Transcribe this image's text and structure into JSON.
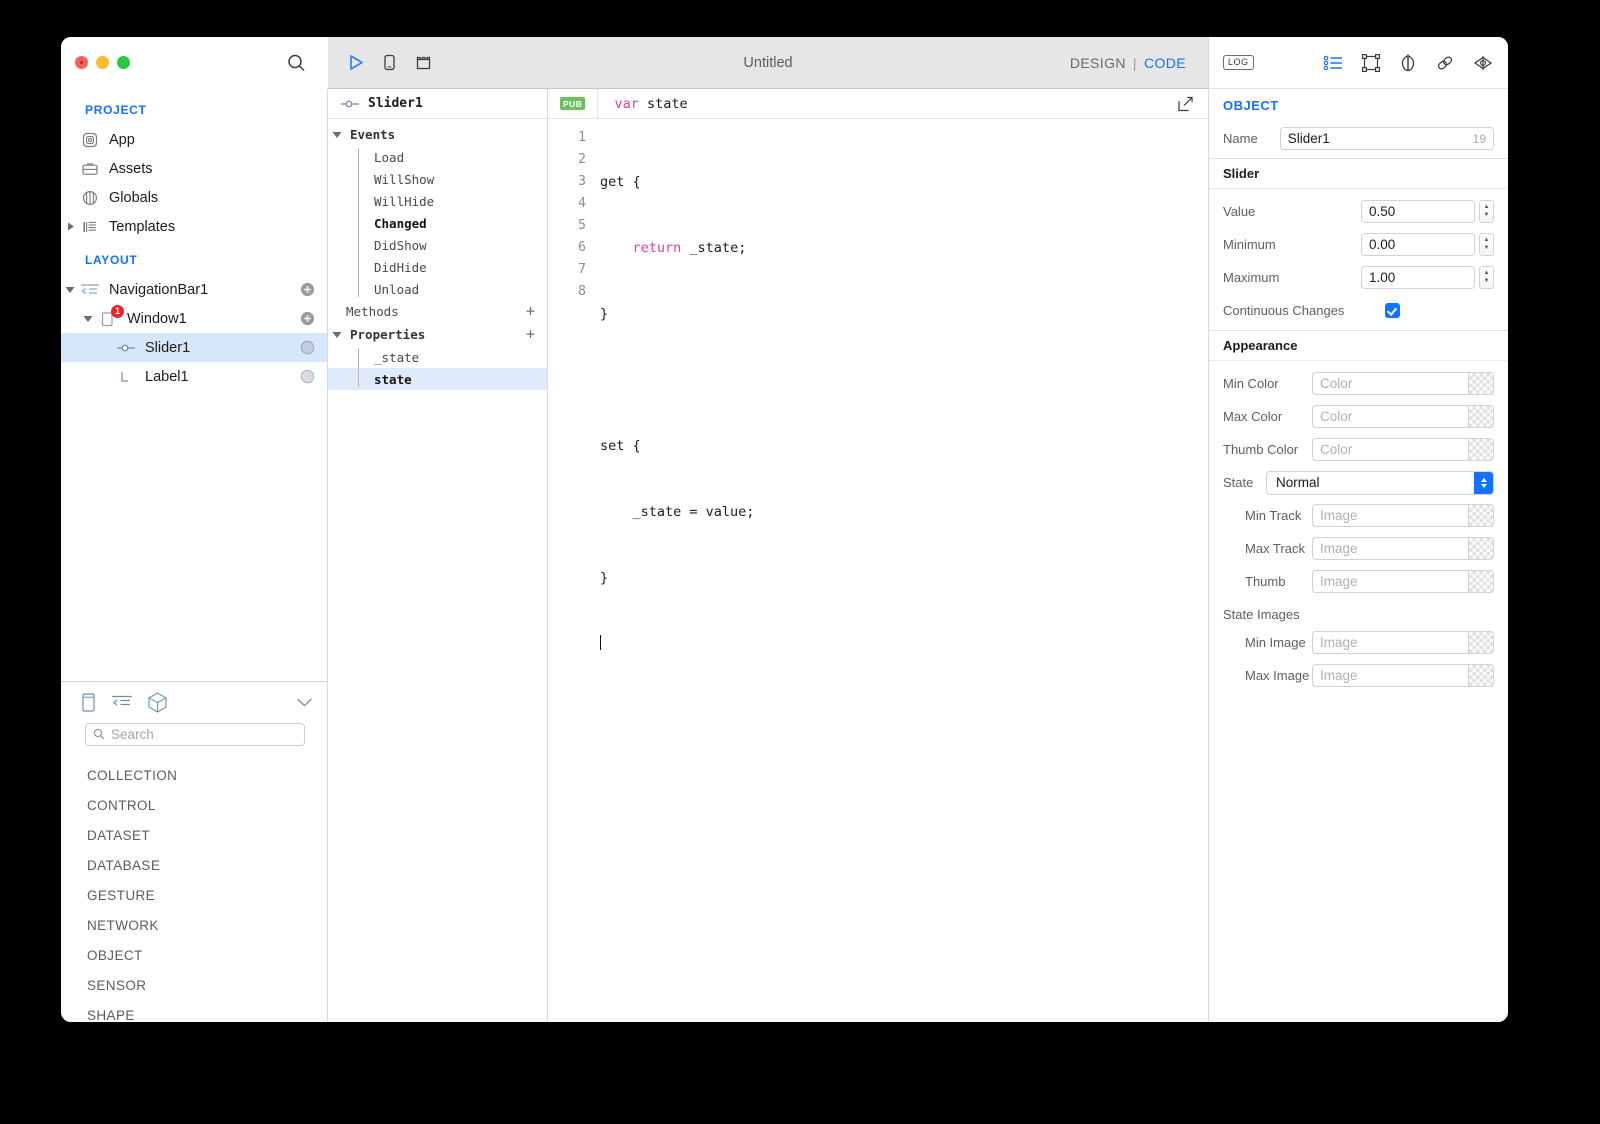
{
  "window": {
    "traffic_lights": [
      "close",
      "minimize",
      "maximize"
    ],
    "sidebar_search_icon": "search-icon"
  },
  "toolbar": {
    "run_icon": "play-triangle-icon",
    "device_icon": "phone-device-icon",
    "layout_icon": "storyboard-icon",
    "title": "Untitled",
    "mode_design": "DESIGN",
    "mode_separator": "|",
    "mode_code": "CODE",
    "accent_blue": "#1273ff"
  },
  "sidebar": {
    "project_header": "PROJECT",
    "project_items": [
      {
        "label": "App",
        "icon": "app-icon"
      },
      {
        "label": "Assets",
        "icon": "assets-briefcase-icon"
      },
      {
        "label": "Globals",
        "icon": "globals-cylinder-icon"
      },
      {
        "label": "Templates",
        "icon": "templates-icon"
      }
    ],
    "layout_header": "LAYOUT",
    "layout_items": [
      {
        "label": "NavigationBar1",
        "icon": "navigationbar-icon",
        "action": "add-icon",
        "badge": ""
      },
      {
        "label": "Window1",
        "icon": "window-icon",
        "action": "add-icon",
        "badge": "1"
      },
      {
        "label": "Slider1",
        "icon": "slider-icon",
        "action": "visibility-dot-icon",
        "badge": "",
        "selected": true
      },
      {
        "label": "Label1",
        "icon": "label-L-icon",
        "action": "visibility-dot-icon",
        "badge": ""
      }
    ]
  },
  "library": {
    "tabs": [
      "phone-outline-icon",
      "navbar-outline-icon",
      "cube-outline-icon"
    ],
    "collapse_icon": "chevron-down-icon",
    "search_placeholder": "Search",
    "search_value": "",
    "search_icon": "search-icon",
    "categories": [
      "COLLECTION",
      "CONTROL",
      "DATASET",
      "DATABASE",
      "GESTURE",
      "NETWORK",
      "OBJECT",
      "SENSOR",
      "SHAPE"
    ]
  },
  "members": {
    "header": "Slider1",
    "header_icon": "slider-icon",
    "groups": [
      {
        "name": "Events",
        "expanded": true,
        "has_add": false,
        "add_label": "+",
        "items": [
          {
            "label": "Load",
            "bold": false
          },
          {
            "label": "WillShow",
            "bold": false
          },
          {
            "label": "WillHide",
            "bold": false
          },
          {
            "label": "Changed",
            "bold": true
          },
          {
            "label": "DidShow",
            "bold": false
          },
          {
            "label": "DidHide",
            "bold": false
          },
          {
            "label": "Unload",
            "bold": false
          }
        ]
      },
      {
        "name": "Methods",
        "expanded": false,
        "has_add": true,
        "add_label": "+",
        "items": []
      },
      {
        "name": "Properties",
        "expanded": true,
        "has_add": true,
        "add_label": "+",
        "items": [
          {
            "label": "_state",
            "bold": false
          },
          {
            "label": "state",
            "bold": true,
            "selected": true
          }
        ]
      }
    ]
  },
  "code": {
    "pub_badge": "PUB",
    "pub_badge_color": "#6ec05e",
    "signature_keyword": "var",
    "signature_name": " state",
    "expand_icon": "open-in-new-icon",
    "line_numbers": [
      "1",
      "2",
      "3",
      "4",
      "5",
      "6",
      "7",
      "8"
    ],
    "lines": [
      "get {",
      "    return _state;",
      "}",
      "",
      "set {",
      "    _state = value;",
      "}",
      ""
    ],
    "keyword_return": "return"
  },
  "inspector": {
    "log_badge": "LOG",
    "tabs": [
      "properties-list-icon",
      "layout-frame-icon",
      "appearance-icon",
      "bindings-link-icon",
      "preview-eye-icon"
    ],
    "object_title": "OBJECT",
    "name_label": "Name",
    "name_value": "Slider1",
    "name_counter": "19",
    "slider_section": "Slider",
    "rows": [
      {
        "label": "Value",
        "value": "0.50",
        "kind": "stepper"
      },
      {
        "label": "Minimum",
        "value": "0.00",
        "kind": "stepper"
      },
      {
        "label": "Maximum",
        "value": "1.00",
        "kind": "stepper"
      }
    ],
    "continuous_label": "Continuous Changes",
    "continuous_checked": true,
    "appearance_section": "Appearance",
    "color_rows": [
      {
        "label": "Min Color",
        "placeholder": "Color"
      },
      {
        "label": "Max Color",
        "placeholder": "Color"
      },
      {
        "label": "Thumb Color",
        "placeholder": "Color"
      }
    ],
    "state_label": "State",
    "state_value": "Normal",
    "state_options": [
      "Normal"
    ],
    "image_rows": [
      {
        "label": "Min Track",
        "placeholder": "Image"
      },
      {
        "label": "Max Track",
        "placeholder": "Image"
      },
      {
        "label": "Thumb",
        "placeholder": "Image"
      }
    ],
    "state_images_label": "State Images",
    "state_image_rows": [
      {
        "label": "Min Image",
        "placeholder": "Image"
      },
      {
        "label": "Max Image",
        "placeholder": "Image"
      }
    ]
  }
}
